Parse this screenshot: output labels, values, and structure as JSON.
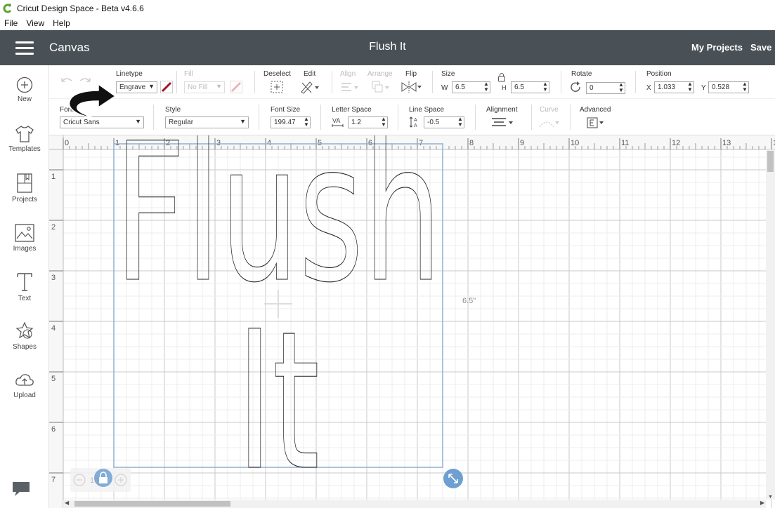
{
  "window": {
    "title": "Cricut Design Space - Beta v4.6.6"
  },
  "menu": [
    "File",
    "View",
    "Help"
  ],
  "header": {
    "section": "Canvas",
    "project_title": "Flush It",
    "my_projects": "My Projects",
    "save": "Save"
  },
  "sidebar": [
    {
      "label": "New",
      "icon": "plus-circle-icon"
    },
    {
      "label": "Templates",
      "icon": "shirt-icon"
    },
    {
      "label": "Projects",
      "icon": "projects-icon"
    },
    {
      "label": "Images",
      "icon": "image-icon"
    },
    {
      "label": "Text",
      "icon": "text-icon"
    },
    {
      "label": "Shapes",
      "icon": "shapes-icon"
    },
    {
      "label": "Upload",
      "icon": "cloud-upload-icon"
    }
  ],
  "toolbar": {
    "linetype": {
      "label": "Linetype",
      "value": "Engrave"
    },
    "fill": {
      "label": "Fill",
      "value": "No Fill"
    },
    "deselect": "Deselect",
    "edit": "Edit",
    "align": "Align",
    "arrange": "Arrange",
    "flip": "Flip",
    "size": {
      "label": "Size",
      "w_label": "W",
      "w": "6.5",
      "h_label": "H",
      "h": "6.5"
    },
    "rotate": {
      "label": "Rotate",
      "value": "0"
    },
    "position": {
      "label": "Position",
      "x_label": "X",
      "x": "1.033",
      "y_label": "Y",
      "y": "0.528"
    }
  },
  "text_toolbar": {
    "font": {
      "label": "Font",
      "value": "Cricut Sans"
    },
    "style": {
      "label": "Style",
      "value": "Regular"
    },
    "font_size": {
      "label": "Font Size",
      "value": "199.47"
    },
    "letter_space": {
      "label": "Letter Space",
      "value": "1.2"
    },
    "line_space": {
      "label": "Line Space",
      "value": "-0.5"
    },
    "alignment": "Alignment",
    "curve": "Curve",
    "advanced": "Advanced"
  },
  "canvas": {
    "ruler_top": [
      "0",
      "1",
      "2",
      "3",
      "4",
      "5",
      "6",
      "7",
      "8",
      "9",
      "10",
      "11",
      "12",
      "13",
      "1"
    ],
    "ruler_left": [
      "1",
      "2",
      "3",
      "4",
      "5",
      "6",
      "7"
    ],
    "dimension_label": "6.5\"",
    "zoom": "100",
    "text_lines": [
      "Flush",
      "It"
    ]
  },
  "colors": {
    "header_bg": "#4a5156",
    "accent": "#6e9fd0",
    "engrave_swatch": "#a0172b"
  }
}
